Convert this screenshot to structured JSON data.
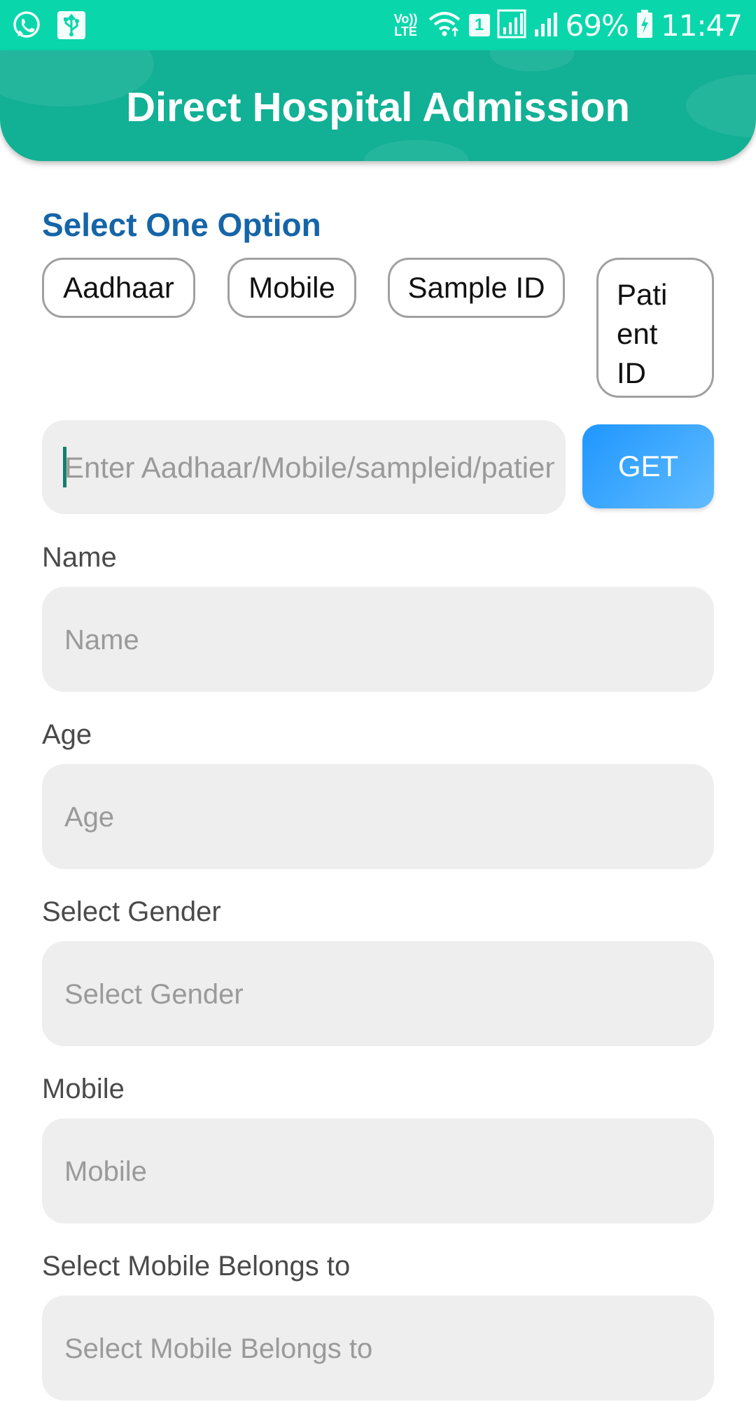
{
  "status_bar": {
    "battery": "69%",
    "time": "11:47",
    "volte": "Vo)) LTE",
    "sim_slot": "1",
    "icons": [
      "whatsapp-icon",
      "usb-icon",
      "volte-icon",
      "wifi-icon",
      "sim-1-icon",
      "signal-icon",
      "signal-icon",
      "battery-charging-icon"
    ]
  },
  "header": {
    "title": "Direct Hospital Admission"
  },
  "options": {
    "title": "Select One Option",
    "chips": [
      "Aadhaar",
      "Mobile",
      "Sample ID",
      "Pati ent ID"
    ]
  },
  "search": {
    "placeholder": "Enter Aadhaar/Mobile/sampleid/patientid",
    "button_label": "GET"
  },
  "form": {
    "fields": [
      {
        "label": "Name",
        "placeholder": "Name"
      },
      {
        "label": "Age",
        "placeholder": "Age"
      },
      {
        "label": "Select Gender",
        "placeholder": "Select Gender"
      },
      {
        "label": "Mobile",
        "placeholder": "Mobile"
      },
      {
        "label": "Select Mobile Belongs to",
        "placeholder": "Select Mobile Belongs to"
      }
    ]
  },
  "colors": {
    "status_bar": "#0ad6ac",
    "header": "#12b095",
    "section_title": "#1565a8",
    "button_gradient_start": "#1e96ff",
    "button_gradient_end": "#62bcff",
    "field_bg": "#eeeeee"
  }
}
